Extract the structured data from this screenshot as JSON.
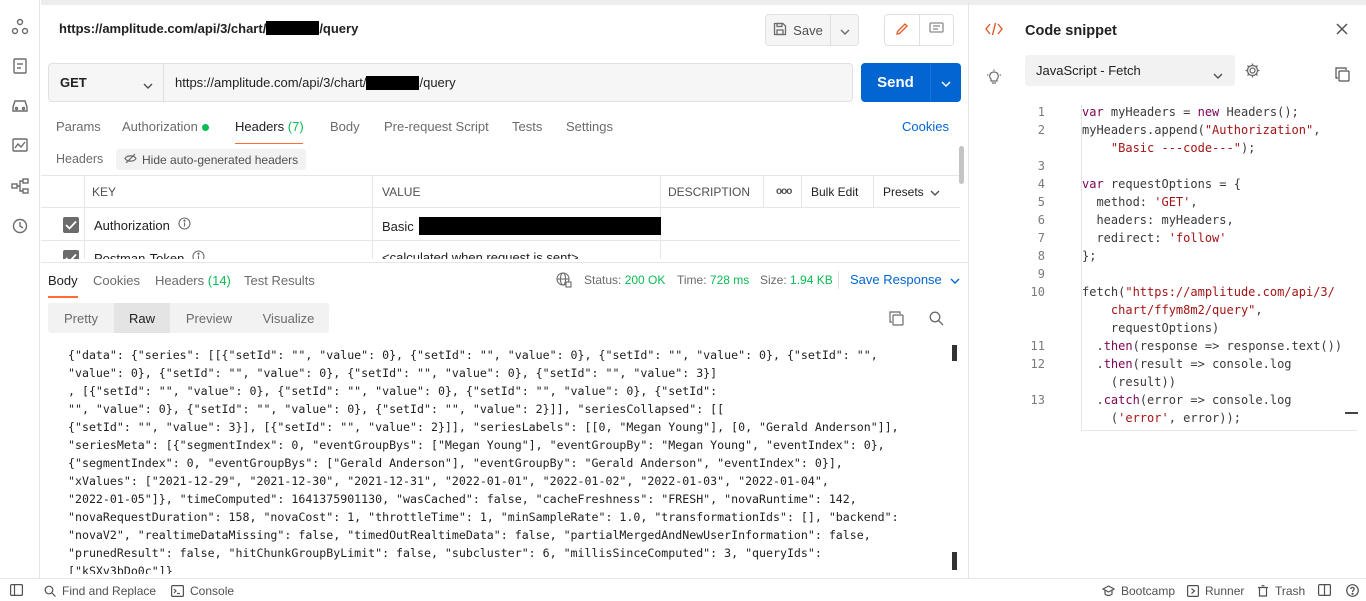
{
  "request": {
    "title_url_prefix": "https://amplitude.com/api/3/chart/",
    "title_url_suffix": "/query",
    "save_label": "Save",
    "method": "GET",
    "url_prefix": "https://amplitude.com/api/3/chart/",
    "url_suffix": "/query",
    "send_label": "Send",
    "tabs": [
      {
        "label": "Params"
      },
      {
        "label": "Authorization"
      },
      {
        "label": "Headers",
        "count": "(7)"
      },
      {
        "label": "Body"
      },
      {
        "label": "Pre-request Script"
      },
      {
        "label": "Tests"
      },
      {
        "label": "Settings"
      }
    ],
    "cookies_label": "Cookies",
    "headers_label": "Headers",
    "hide_auto_label": "Hide auto-generated headers",
    "table": {
      "col_key": "KEY",
      "col_value": "VALUE",
      "col_description": "DESCRIPTION",
      "more": "ooo",
      "bulk_edit": "Bulk Edit",
      "presets": "Presets",
      "rows": [
        {
          "key": "Authorization",
          "value": "Basic"
        },
        {
          "key": "Postman-Token",
          "value": "<calculated when request is sent>"
        }
      ]
    }
  },
  "response": {
    "tabs": [
      {
        "label": "Body"
      },
      {
        "label": "Cookies"
      },
      {
        "label": "Headers",
        "count": "(14)"
      },
      {
        "label": "Test Results"
      }
    ],
    "status_label": "Status:",
    "status_value": "200 OK",
    "time_label": "Time:",
    "time_value": "728 ms",
    "size_label": "Size:",
    "size_value": "1.94 KB",
    "save_response": "Save Response",
    "view_tabs": [
      "Pretty",
      "Raw",
      "Preview",
      "Visualize"
    ],
    "body_lines": [
      "{\"data\": {\"series\": [[{\"setId\": \"\", \"value\": 0}, {\"setId\": \"\", \"value\": 0}, {\"setId\": \"\", \"value\": 0}, {\"setId\": \"\",",
      "\"value\": 0}, {\"setId\": \"\", \"value\": 0}, {\"setId\": \"\", \"value\": 0}, {\"setId\": \"\", \"value\": 3}]",
      ", [{\"setId\": \"\", \"value\": 0}, {\"setId\": \"\", \"value\": 0}, {\"setId\": \"\", \"value\": 0}, {\"setId\":",
      "\"\", \"value\": 0}, {\"setId\": \"\", \"value\": 0}, {\"setId\": \"\", \"value\": 2}]], \"seriesCollapsed\": [[",
      "{\"setId\": \"\", \"value\": 3}], [{\"setId\": \"\", \"value\": 2}]], \"seriesLabels\": [[0, \"Megan Young\"], [0, \"Gerald Anderson\"]],",
      "\"seriesMeta\": [{\"segmentIndex\": 0, \"eventGroupBys\": [\"Megan Young\"], \"eventGroupBy\": \"Megan Young\", \"eventIndex\": 0},",
      "{\"segmentIndex\": 0, \"eventGroupBys\": [\"Gerald Anderson\"], \"eventGroupBy\": \"Gerald Anderson\", \"eventIndex\": 0}],",
      "\"xValues\": [\"2021-12-29\", \"2021-12-30\", \"2021-12-31\", \"2022-01-01\", \"2022-01-02\", \"2022-01-03\", \"2022-01-04\",",
      "\"2022-01-05\"]}, \"timeComputed\": 1641375901130, \"wasCached\": false, \"cacheFreshness\": \"FRESH\", \"novaRuntime\": 142,",
      "\"novaRequestDuration\": 158, \"novaCost\": 1, \"throttleTime\": 1, \"minSampleRate\": 1.0, \"transformationIds\": [], \"backend\":",
      "\"novaV2\", \"realtimeDataMissing\": false, \"timedOutRealtimeData\": false, \"partialMergedAndNewUserInformation\": false,",
      "\"prunedResult\": false, \"hitChunkGroupByLimit\": false, \"subcluster\": 6, \"millisSinceComputed\": 3, \"queryIds\":",
      "[\"kSXv3bDo0c\"]}"
    ]
  },
  "snippet": {
    "title": "Code snippet",
    "language": "JavaScript - Fetch",
    "line_numbers": [
      "1",
      "2",
      "",
      "3",
      "4",
      "5",
      "6",
      "7",
      "8",
      "9",
      "10",
      "",
      "",
      "11",
      "12",
      "",
      "13",
      ""
    ]
  },
  "statusbar": {
    "find_replace": "Find and Replace",
    "console": "Console",
    "bootcamp": "Bootcamp",
    "runner": "Runner",
    "trash": "Trash"
  }
}
